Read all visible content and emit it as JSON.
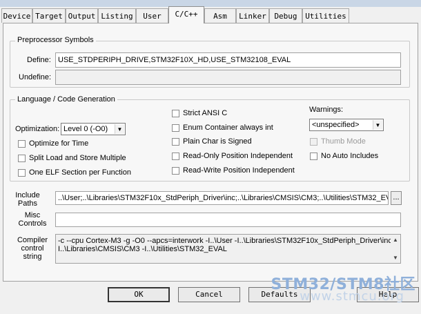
{
  "tabs": [
    {
      "label": "Device"
    },
    {
      "label": "Target"
    },
    {
      "label": "Output"
    },
    {
      "label": "Listing"
    },
    {
      "label": "User"
    },
    {
      "label": "C/C++"
    },
    {
      "label": "Asm"
    },
    {
      "label": "Linker"
    },
    {
      "label": "Debug"
    },
    {
      "label": "Utilities"
    }
  ],
  "preprocessor": {
    "title": "Preprocessor Symbols",
    "define_label": "Define:",
    "define_value": "USE_STDPERIPH_DRIVE,STM32F10X_HD,USE_STM32108_EVAL",
    "undefine_label": "Undefine:",
    "undefine_value": ""
  },
  "language": {
    "title": "Language / Code Generation",
    "optimization_label": "Optimization:",
    "optimization_value": "Level 0 (-O0)",
    "warnings_label": "Warnings:",
    "warnings_value": "<unspecified>",
    "checkboxes": {
      "optimize_time": {
        "label": "Optimize for Time",
        "checked": false
      },
      "split_load": {
        "label": "Split Load and Store Multiple",
        "checked": false
      },
      "one_elf": {
        "label": "One ELF Section per Function",
        "checked": false
      },
      "strict_ansi": {
        "label": "Strict ANSI C",
        "checked": false
      },
      "enum_container": {
        "label": "Enum Container always int",
        "checked": false
      },
      "plain_char": {
        "label": "Plain Char is Signed",
        "checked": false
      },
      "readonly_pos": {
        "label": "Read-Only Position Independent",
        "checked": false
      },
      "readwrite_pos": {
        "label": "Read-Write Position Independent",
        "checked": false
      },
      "thumb_mode": {
        "label": "Thumb Mode",
        "checked": false
      },
      "no_auto_includes": {
        "label": "No Auto Includes",
        "checked": false
      }
    }
  },
  "include_paths": {
    "label_line1": "Include",
    "label_line2": "Paths",
    "value": "..\\User;..\\Libraries\\STM32F10x_StdPeriph_Driver\\inc;..\\Libraries\\CMSIS\\CM3;..\\Utilities\\STM32_EV",
    "browse_label": "..."
  },
  "misc_controls": {
    "label_line1": "Misc",
    "label_line2": "Controls",
    "value": ""
  },
  "compiler_string": {
    "label_line1": "Compiler",
    "label_line2": "control",
    "label_line3": "string",
    "line1": "-c --cpu Cortex-M3 -g -O0 --apcs=interwork -I..\\User -I..\\Libraries\\STM32F10x_StdPeriph_Driver\\inc -",
    "line2": "I..\\Libraries\\CMSIS\\CM3 -I..\\Utilities\\STM32_EVAL"
  },
  "buttons": {
    "ok": "OK",
    "cancel": "Cancel",
    "defaults": "Defaults",
    "help": "Help"
  },
  "watermark": {
    "line1": "STM32/STM8社区",
    "line2": "www.stmcu.org"
  }
}
